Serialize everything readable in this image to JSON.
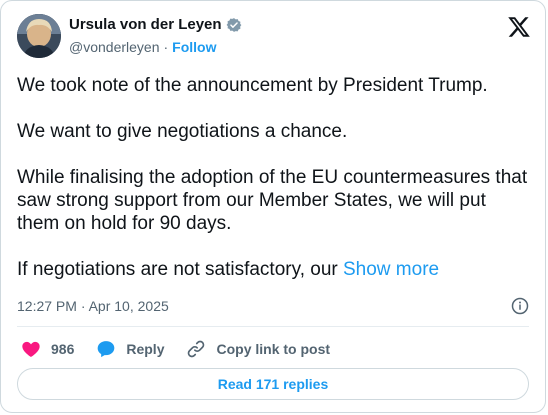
{
  "author": {
    "name": "Ursula von der Leyen",
    "handle": "@vonderleyen",
    "separator": "·",
    "follow_label": "Follow"
  },
  "tweet": {
    "paragraphs": [
      "We took note of the announcement by President Trump.",
      "We want to give negotiations a chance.",
      "While finalising the adoption of the EU countermeasures that saw strong support from our Member States, we will put them on hold for 90 days."
    ],
    "truncated_text": "If negotiations are not satisfactory, our",
    "show_more_label": "Show more",
    "timestamp": "12:27 PM · Apr 10, 2025"
  },
  "actions": {
    "like_count": "986",
    "reply_label": "Reply",
    "copy_link_label": "Copy link to post"
  },
  "read_replies_label": "Read 171 replies",
  "colors": {
    "accent": "#1d9bf0",
    "like": "#f91880",
    "text": "#0f1419",
    "secondary": "#536471"
  }
}
